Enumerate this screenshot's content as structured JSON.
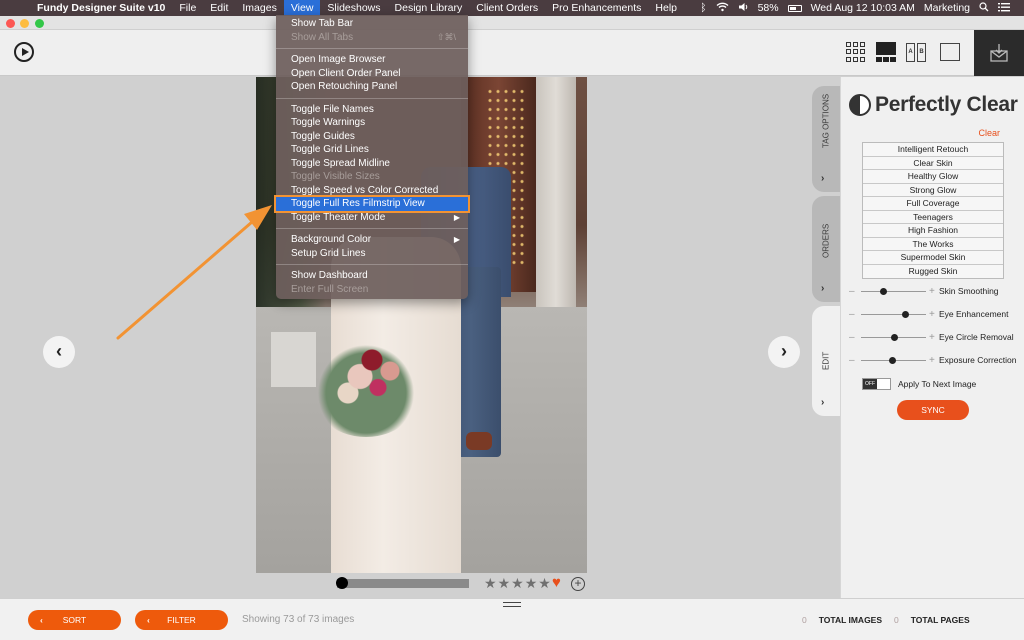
{
  "menubar": {
    "app_name": "Fundy Designer Suite v10",
    "items": [
      "File",
      "Edit",
      "Images",
      "View",
      "Slideshows",
      "Design Library",
      "Client Orders",
      "Pro Enhancements",
      "Help"
    ],
    "active_item": "View",
    "status": {
      "battery": "58%",
      "datetime": "Wed Aug 12  10:03 AM",
      "user": "Marketing"
    }
  },
  "view_menu": {
    "groups": [
      [
        {
          "label": "Show Tab Bar",
          "enabled": true
        },
        {
          "label": "Show All Tabs",
          "enabled": false,
          "shortcut": "⇧⌘\\"
        }
      ],
      [
        {
          "label": "Open Image Browser",
          "enabled": true
        },
        {
          "label": "Open Client Order Panel",
          "enabled": true
        },
        {
          "label": "Open Retouching Panel",
          "enabled": true
        }
      ],
      [
        {
          "label": "Toggle File Names",
          "enabled": true
        },
        {
          "label": "Toggle Warnings",
          "enabled": true
        },
        {
          "label": "Toggle Guides",
          "enabled": true
        },
        {
          "label": "Toggle Grid Lines",
          "enabled": true
        },
        {
          "label": "Toggle Spread Midline",
          "enabled": true
        },
        {
          "label": "Toggle Visible Sizes",
          "enabled": false
        },
        {
          "label": "Toggle Speed vs Color Corrected",
          "enabled": true
        },
        {
          "label": "Toggle Full Res Filmstrip View",
          "enabled": true,
          "highlighted": true
        },
        {
          "label": "Toggle Theater Mode",
          "enabled": true,
          "submenu": true
        }
      ],
      [
        {
          "label": "Background Color",
          "enabled": true,
          "submenu": true
        },
        {
          "label": "Setup Grid Lines",
          "enabled": true
        }
      ],
      [
        {
          "label": "Show Dashboard",
          "enabled": true
        },
        {
          "label": "Enter Full Screen",
          "enabled": false
        }
      ]
    ]
  },
  "toolbar": {
    "play_icon": "play-circle-icon",
    "view_modes": [
      "grid-view-icon",
      "filmstrip-view-icon",
      "compare-ab-icon",
      "single-view-icon"
    ],
    "ab_labels": [
      "A",
      "B"
    ],
    "export_icon": "export-box-icon"
  },
  "viewer": {
    "prev_icon": "chevron-left-icon",
    "next_icon": "chevron-right-icon",
    "prev_glyph": "‹",
    "next_glyph": "›",
    "scrub_progress": 0,
    "rating": {
      "value": 0,
      "max": 5,
      "glyph": "★"
    },
    "favorite_glyph": "♥",
    "favorite": true,
    "add_glyph": "+"
  },
  "side_tabs": [
    {
      "label": "TAG OPTIONS",
      "active": false
    },
    {
      "label": "ORDERS",
      "active": false
    },
    {
      "label": "EDIT",
      "active": true
    }
  ],
  "side_tab_chevron": "›",
  "panel": {
    "title": "Perfectly Clear",
    "clear_label": "Clear",
    "presets": [
      "Intelligent Retouch",
      "Clear Skin",
      "Healthy Glow",
      "Strong Glow",
      "Full Coverage",
      "Teenagers",
      "High Fashion",
      "The Works",
      "Supermodel Skin",
      "Rugged Skin"
    ],
    "sliders": [
      {
        "label": "Skin Smoothing",
        "value": 0.35
      },
      {
        "label": "Eye Enhancement",
        "value": 0.68
      },
      {
        "label": "Eye Circle Removal",
        "value": 0.52
      },
      {
        "label": "Exposure Correction",
        "value": 0.48
      }
    ],
    "slider_minus": "–",
    "slider_plus": "+",
    "apply_next": {
      "label": "Apply To Next Image",
      "state_label": "OFF",
      "on": false
    },
    "sync_label": "SYNC"
  },
  "bottom": {
    "sort_label": "SORT",
    "filter_label": "FILTER",
    "chevron": "‹",
    "showing_text": "Showing 73 of 73 images",
    "total_images_count": "0",
    "total_images_label": "TOTAL IMAGES",
    "total_pages_count": "0",
    "total_pages_label": "TOTAL PAGES"
  },
  "colors": {
    "accent": "#ee5a0c",
    "menu_highlight": "#2a6fd8",
    "annotation": "#f29333"
  }
}
